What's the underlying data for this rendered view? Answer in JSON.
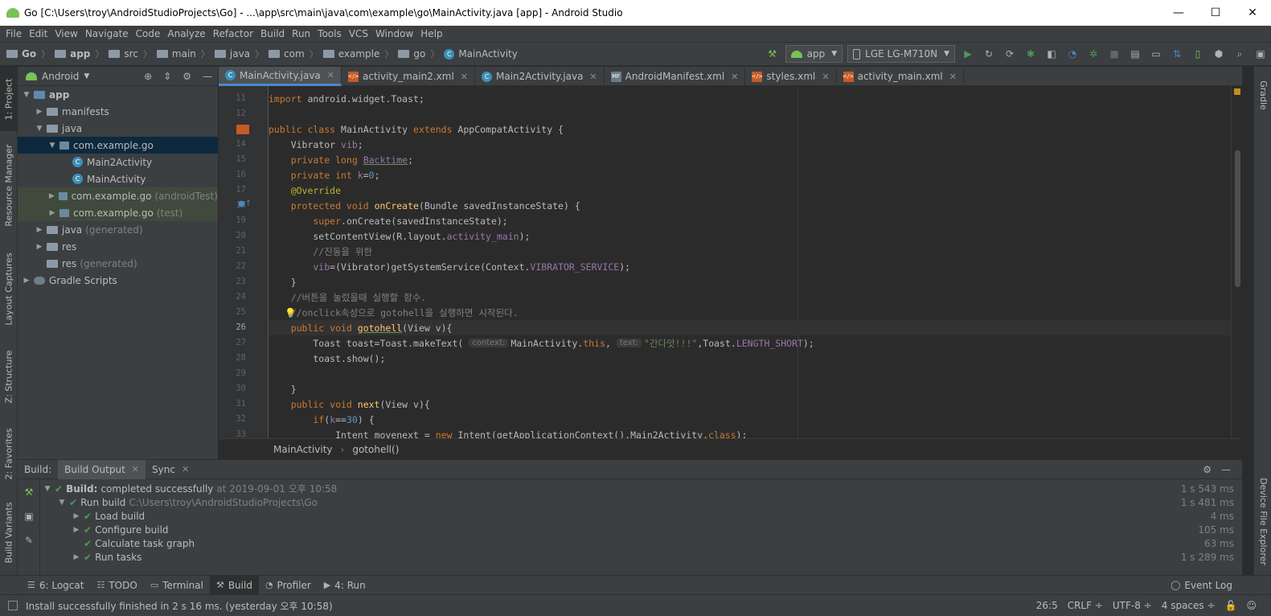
{
  "window": {
    "title": "Go [C:\\Users\\troy\\AndroidStudioProjects\\Go] - ...\\app\\src\\main\\java\\com\\example\\go\\MainActivity.java [app] - Android Studio",
    "minimize": "—",
    "maximize": "☐",
    "close": "✕"
  },
  "menu": [
    "File",
    "Edit",
    "View",
    "Navigate",
    "Code",
    "Analyze",
    "Refactor",
    "Build",
    "Run",
    "Tools",
    "VCS",
    "Window",
    "Help"
  ],
  "nav": {
    "crumbs": [
      "Go",
      "app",
      "src",
      "main",
      "java",
      "com",
      "example",
      "go",
      "MainActivity"
    ],
    "config": "app",
    "device": "LGE LG-M710N"
  },
  "left_strip": [
    "1: Project",
    "Resource Manager",
    "Layout Captures",
    "Z: Structure",
    "2: Favorites",
    "Build Variants"
  ],
  "right_strip": [
    "Gradle",
    "Device File Explorer"
  ],
  "project": {
    "view": "Android",
    "tree": [
      {
        "label": "app",
        "extra": ""
      },
      {
        "label": "manifests",
        "extra": ""
      },
      {
        "label": "java",
        "extra": ""
      },
      {
        "label": "com.example.go",
        "extra": ""
      },
      {
        "label": "Main2Activity",
        "extra": ""
      },
      {
        "label": "MainActivity",
        "extra": ""
      },
      {
        "label": "com.example.go",
        "extra": "(androidTest)"
      },
      {
        "label": "com.example.go",
        "extra": "(test)"
      },
      {
        "label": "java",
        "extra": "(generated)"
      },
      {
        "label": "res",
        "extra": ""
      },
      {
        "label": "res",
        "extra": "(generated)"
      },
      {
        "label": "Gradle Scripts",
        "extra": ""
      }
    ]
  },
  "tabs": [
    "MainActivity.java",
    "activity_main2.xml",
    "Main2Activity.java",
    "AndroidManifest.xml",
    "styles.xml",
    "activity_main.xml"
  ],
  "editor": {
    "line_numbers": [
      "11",
      "12",
      "13",
      "14",
      "15",
      "16",
      "17",
      "18",
      "19",
      "20",
      "21",
      "22",
      "23",
      "24",
      "25",
      "26",
      "27",
      "28",
      "29",
      "30",
      "31",
      "32",
      "33"
    ],
    "top_partial": "import android.widget.Toast;",
    "breadcrumb": [
      "MainActivity",
      "gotohell()"
    ]
  },
  "build": {
    "label": "Build:",
    "tabs": [
      "Build Output",
      "Sync"
    ],
    "rows": [
      {
        "text": "Build:",
        "detail": "completed successfully",
        "extra": "at 2019-09-01 오후 10:58",
        "time": "1 s 543 ms"
      },
      {
        "text": "Run build",
        "detail": "",
        "extra": "C:\\Users\\troy\\AndroidStudioProjects\\Go",
        "time": "1 s 481 ms"
      },
      {
        "text": "Load build",
        "detail": "",
        "extra": "",
        "time": "4 ms"
      },
      {
        "text": "Configure build",
        "detail": "",
        "extra": "",
        "time": "105 ms"
      },
      {
        "text": "Calculate task graph",
        "detail": "",
        "extra": "",
        "time": "63 ms"
      },
      {
        "text": "Run tasks",
        "detail": "",
        "extra": "",
        "time": "1 s 289 ms"
      }
    ]
  },
  "toolwindows": [
    "6: Logcat",
    "TODO",
    "Terminal",
    "Build",
    "Profiler",
    "4: Run"
  ],
  "event_log": "Event Log",
  "status": {
    "message": "Install successfully finished in 2 s 16 ms. (yesterday 오후 10:58)",
    "position": "26:5",
    "line_sep": "CRLF ÷",
    "encoding": "UTF-8 ÷",
    "indent": "4 spaces ÷"
  }
}
